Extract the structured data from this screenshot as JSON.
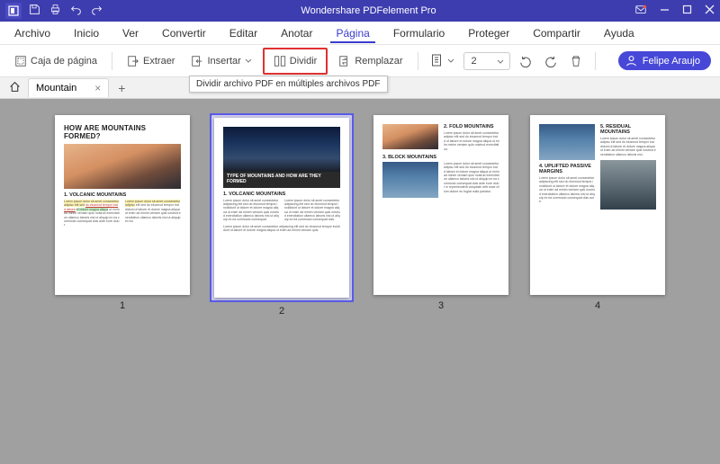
{
  "app": {
    "title": "Wondershare PDFelement Pro"
  },
  "menu": {
    "items": [
      "Archivo",
      "Inicio",
      "Ver",
      "Convertir",
      "Editar",
      "Anotar",
      "Página",
      "Formulario",
      "Proteger",
      "Compartir",
      "Ayuda"
    ],
    "active": "Página"
  },
  "toolbar": {
    "page_box": "Caja de página",
    "extract": "Extraer",
    "insert": "Insertar",
    "split": "Dividir",
    "replace": "Remplazar",
    "page_value": "2",
    "tooltip": "Dividir archivo PDF en múltiples archivos PDF"
  },
  "user": {
    "name": "Felipe Araujo"
  },
  "tab": {
    "label": "Mountain"
  },
  "pages": {
    "numbers": [
      "1",
      "2",
      "3",
      "4"
    ],
    "p1": {
      "title": "HOW ARE MOUNTAINS FORMED?",
      "sub": "1. VOLCANIC MOUNTAINS"
    },
    "p2": {
      "band": "TYPE OF MOUNTAINS AND HOW ARE THEY FORMED",
      "sub": "1. VOLCANIC MOUNTAINS"
    },
    "p3": {
      "sub1": "2. FOLD MOUNTAINS",
      "sub2": "3. BLOCK MOUNTAINS"
    },
    "p4": {
      "sub1": "4. UPLIFTED PASSIVE MARGINS",
      "sub2": "5. RESIDUAL MOUNTAINS"
    }
  }
}
